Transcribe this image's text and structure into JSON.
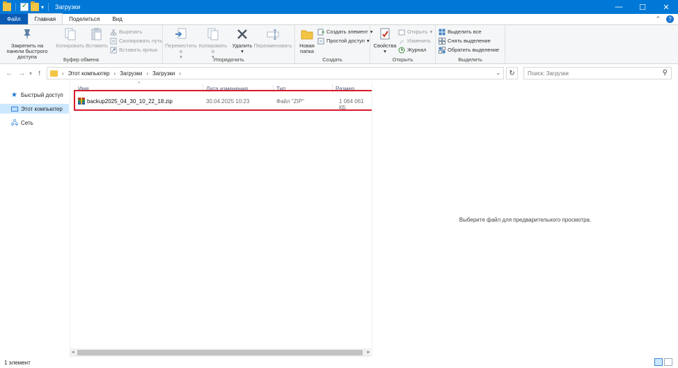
{
  "window": {
    "title": "Загрузки",
    "min_glyph": "—",
    "max_glyph": "☐",
    "close_glyph": "✕"
  },
  "tabs": {
    "file": "Файл",
    "home": "Главная",
    "share": "Поделиться",
    "view": "Вид"
  },
  "ribbon": {
    "clipboard": {
      "label": "Буфер обмена",
      "pin": "Закрепить на панели быстрого доступа",
      "copy": "Копировать",
      "paste": "Вставить",
      "cut": "Вырезать",
      "copy_path": "Скопировать путь",
      "paste_shortcut": "Вставить ярлык"
    },
    "organize": {
      "label": "Упорядочить",
      "move_to": "Переместить в",
      "copy_to": "Копировать в",
      "delete": "Удалить",
      "rename": "Переименовать"
    },
    "new": {
      "label": "Создать",
      "new_folder": "Новая папка",
      "new_item": "Создать элемент",
      "easy_access": "Простой доступ"
    },
    "open": {
      "label": "Открыть",
      "properties": "Свойства",
      "open": "Открыть",
      "edit": "Изменить",
      "history": "Журнал"
    },
    "select": {
      "label": "Выделить",
      "select_all": "Выделить все",
      "select_none": "Снять выделение",
      "invert": "Обратить выделение"
    }
  },
  "address": {
    "crumbs": [
      "Этот компьютер",
      "Загрузки",
      "Загрузки"
    ],
    "search_placeholder": "Поиск: Загрузки"
  },
  "nav": {
    "quick_access": "Быстрый доступ",
    "this_pc": "Этот компьютер",
    "network": "Сеть"
  },
  "columns": {
    "name": "Имя",
    "date": "Дата изменения",
    "type": "Тип",
    "size": "Размер"
  },
  "files": [
    {
      "name": "backup2025_04_30_10_22_18.zip",
      "date": "30.04.2025 10:23",
      "type": "Файл \"ZIP\"",
      "size": "1 064 061 КБ"
    }
  ],
  "preview": {
    "message": "Выберите файл для предварительного просмотра."
  },
  "status": {
    "count": "1 элемент"
  },
  "colors": {
    "titlebar": "#0078d7",
    "selection": "#cce8ff",
    "highlight_box": "#d7192a"
  }
}
